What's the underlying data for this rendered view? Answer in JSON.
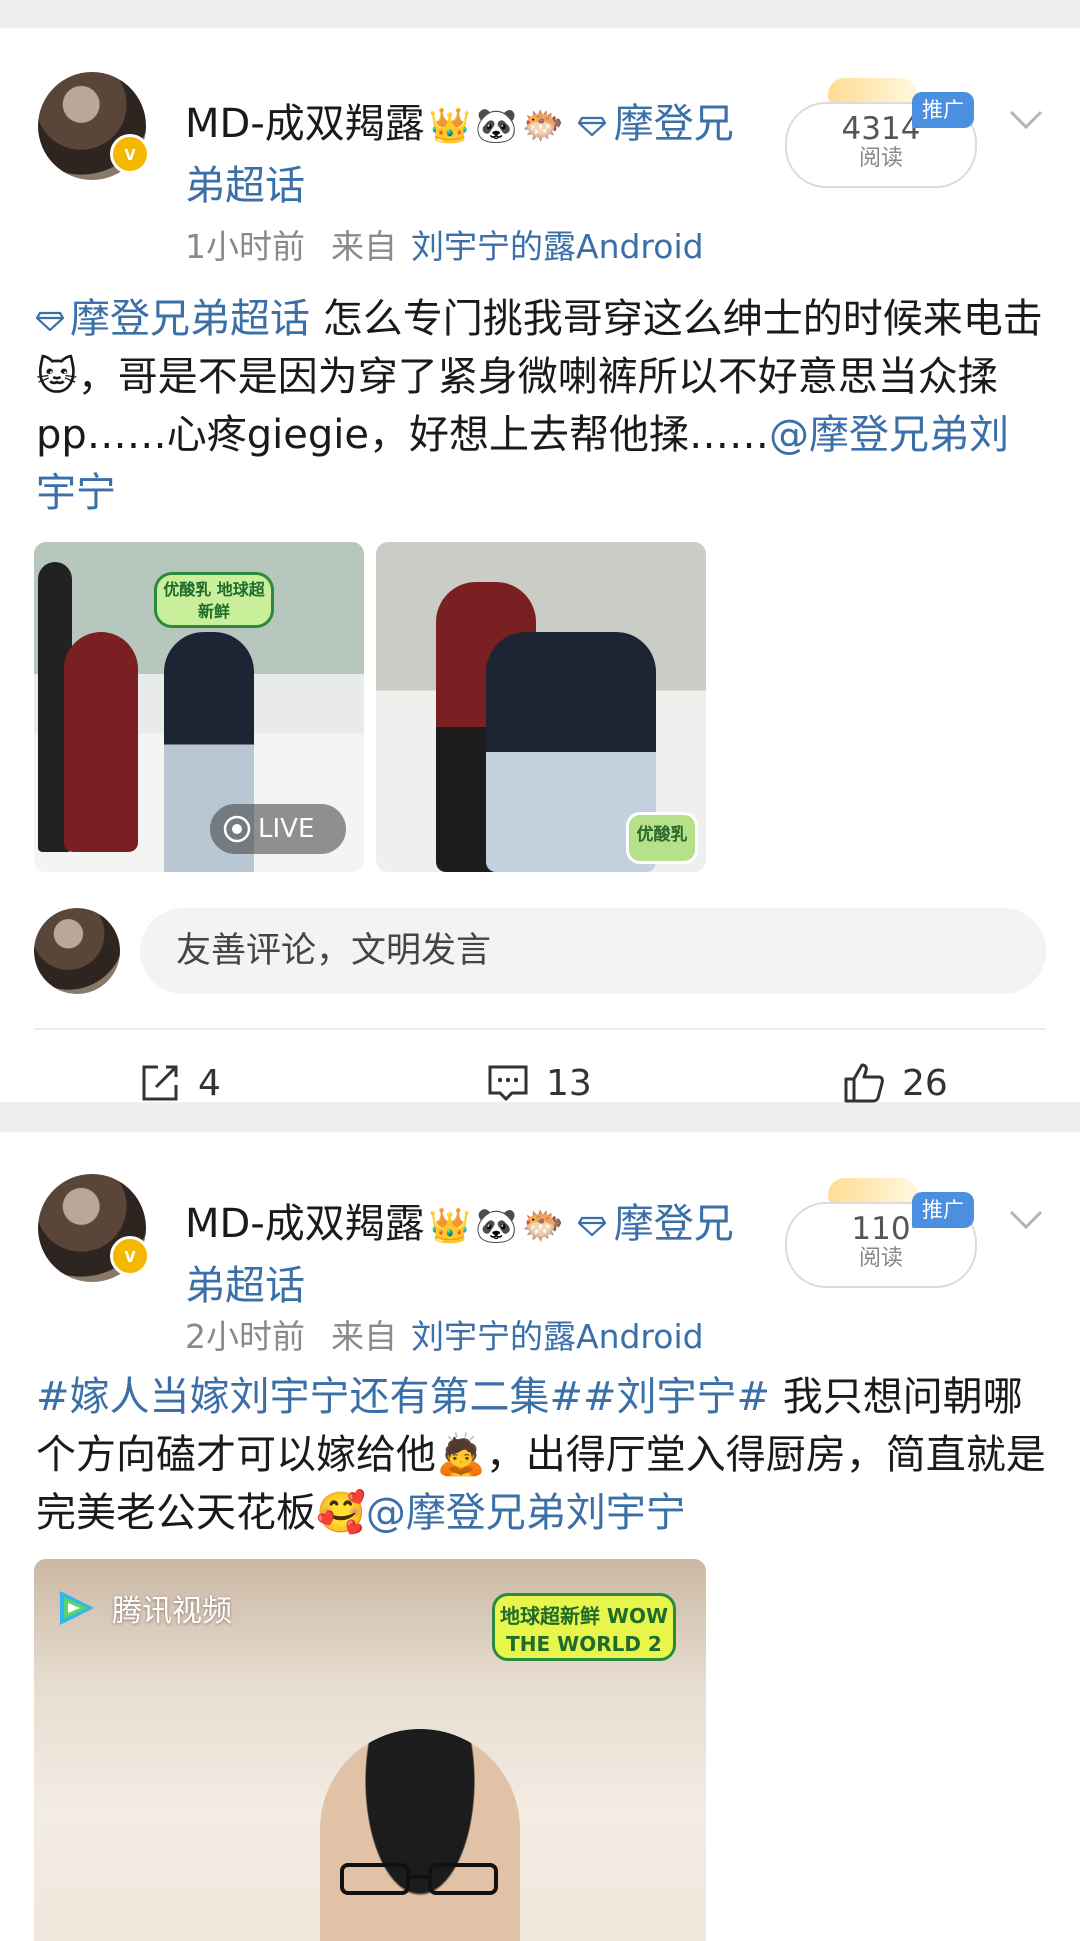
{
  "posts": [
    {
      "username": "MD-成双羯露",
      "badges": [
        "👑",
        "🐼",
        "🐡"
      ],
      "supertopic": "摩登兄弟超话",
      "time": "1小时前",
      "from_label": "来自",
      "source": "刘宇宁的露Android",
      "reads_count": "4314",
      "reads_label": "阅读",
      "promo_label": "推广",
      "content": {
        "topic_link": "摩登兄弟超话",
        "text1": " 怎么专门挑我哥穿这么绅士的时候来电击",
        "emoji1": "🐱",
        "text2": "，哥是不是因为穿了紧身微喇裤所以不好意思当众揉pp……心疼giegie，好想上去帮他揉……",
        "mention": "@摩登兄弟刘宇宁"
      },
      "images": [
        {
          "label": "LIVE",
          "show_logo": "优酸乳 地球超新鲜"
        },
        {
          "sticker": "优酸乳"
        }
      ],
      "comment_placeholder": "友善评论，文明发言",
      "actions": {
        "reposts": "4",
        "comments": "13",
        "likes": "26"
      }
    },
    {
      "username": "MD-成双羯露",
      "badges": [
        "👑",
        "🐼",
        "🐡"
      ],
      "supertopic": "摩登兄弟超话",
      "time": "2小时前",
      "from_label": "来自",
      "source": "刘宇宁的露Android",
      "reads_count": "110",
      "reads_label": "阅读",
      "promo_label": "推广",
      "content": {
        "hashtag1": "#嫁人当嫁刘宇宁还有第二集#",
        "hashtag2": "#刘宇宁#",
        "text1": " 我只想问朝哪个方向磕才可以嫁给他",
        "emoji1": "🙇",
        "text2": "，出得厅堂入得厨房，简直就是完美老公天花板",
        "emoji2": "🥰",
        "mention": "@摩登兄弟刘宇宁"
      },
      "video": {
        "platform": "腾讯视频",
        "show_logo": "地球超新鲜 WOW THE WORLD 2"
      }
    }
  ],
  "colors": {
    "link": "#3a6fa8",
    "promo": "#4a8fe0",
    "vip": "#f5b800"
  }
}
